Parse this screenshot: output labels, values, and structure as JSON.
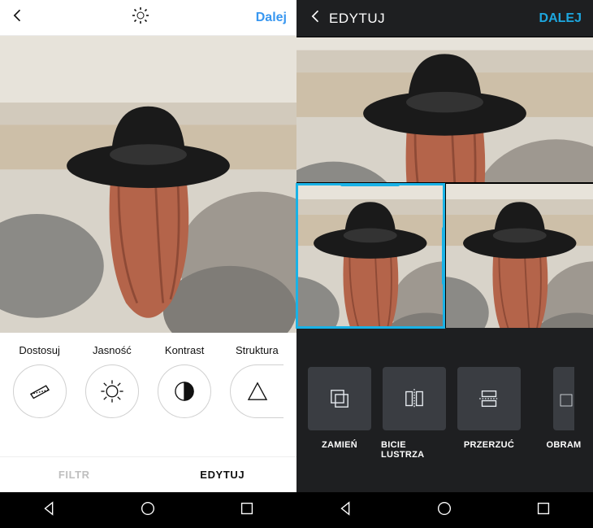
{
  "left": {
    "header": {
      "next": "Dalej"
    },
    "tools": [
      {
        "label": "Dostosuj",
        "icon": "adjust"
      },
      {
        "label": "Jasność",
        "icon": "brightness"
      },
      {
        "label": "Kontrast",
        "icon": "contrast"
      },
      {
        "label": "Struktura",
        "icon": "structure"
      }
    ],
    "tabs": {
      "filter": "FILTR",
      "edit": "EDYTUJ",
      "active": "edit"
    }
  },
  "right": {
    "header": {
      "title": "EDYTUJ",
      "next": "DALEJ"
    },
    "collage": {
      "selected_cell": 1
    },
    "actions": [
      {
        "label": "ZAMIEŃ",
        "icon": "replace"
      },
      {
        "label": "BICIE LUSTRZA",
        "icon": "mirror"
      },
      {
        "label": "PRZERZUĆ",
        "icon": "flip"
      },
      {
        "label": "OBRAM",
        "icon": "border"
      }
    ]
  },
  "colors": {
    "ig_accent": "#3897f0",
    "dark_accent": "#1da6de",
    "select": "#19b2e6",
    "tile": "#3a3d42"
  }
}
